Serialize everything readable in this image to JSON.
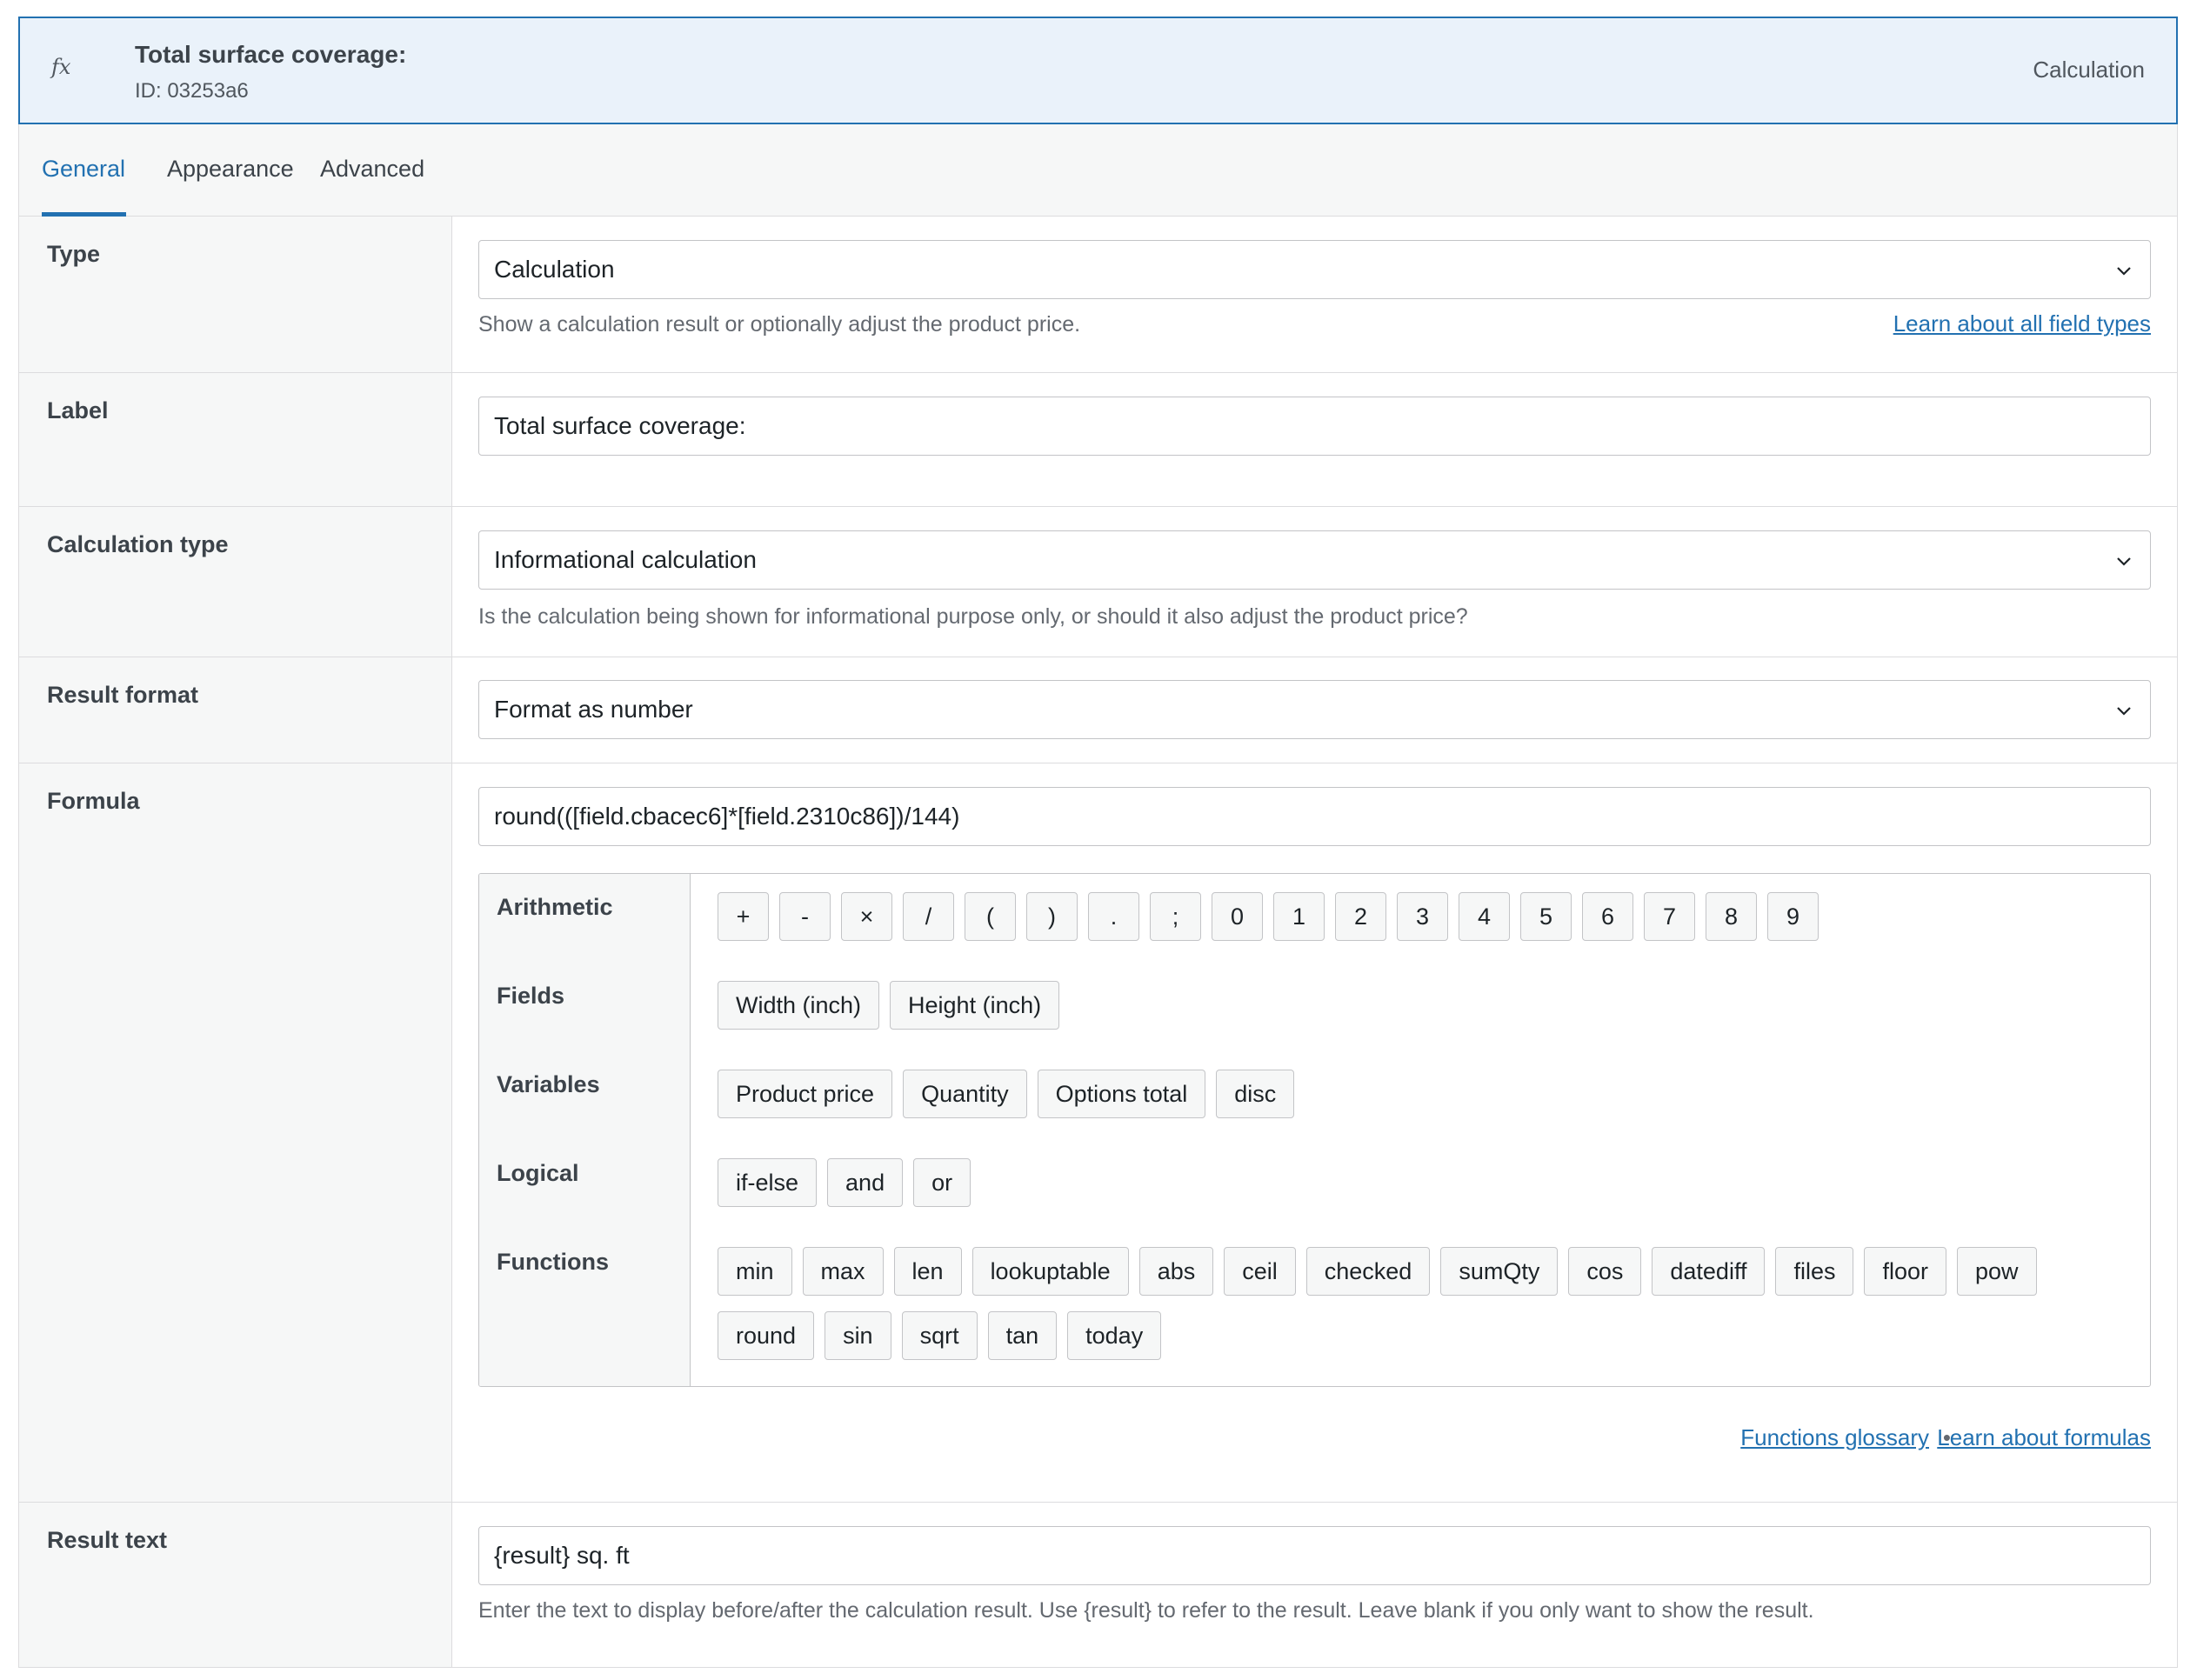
{
  "header": {
    "icon": "fx-icon",
    "title": "Total surface coverage:",
    "id_text": "ID: 03253a6",
    "type_label": "Calculation"
  },
  "tabs": [
    {
      "label": "General",
      "active": true
    },
    {
      "label": "Appearance",
      "active": false
    },
    {
      "label": "Advanced",
      "active": false
    }
  ],
  "type_row": {
    "label": "Type",
    "value": "Calculation",
    "help": "Show a calculation result or optionally adjust the product price.",
    "link": "Learn about all field types"
  },
  "label_row": {
    "label": "Label",
    "value": "Total surface coverage:"
  },
  "calc_type_row": {
    "label": "Calculation type",
    "value": "Informational calculation",
    "help": "Is the calculation being shown for informational purpose only, or should it also adjust the product price?"
  },
  "result_format_row": {
    "label": "Result format",
    "value": "Format as number"
  },
  "formula_row": {
    "label": "Formula",
    "value": "round(([field.cbacec6]*[field.2310c86])/144)",
    "categories": {
      "arithmetic": "Arithmetic",
      "fields": "Fields",
      "variables": "Variables",
      "logical": "Logical",
      "functions": "Functions"
    },
    "arithmetic": [
      "+",
      "-",
      "×",
      "/",
      "(",
      ")",
      ".",
      ";",
      "0",
      "1",
      "2",
      "3",
      "4",
      "5",
      "6",
      "7",
      "8",
      "9"
    ],
    "fields": [
      "Width (inch)",
      "Height (inch)"
    ],
    "variables": [
      "Product price",
      "Quantity",
      "Options total",
      "disc"
    ],
    "logical": [
      "if-else",
      "and",
      "or"
    ],
    "functions": [
      "min",
      "max",
      "len",
      "lookuptable",
      "abs",
      "ceil",
      "checked",
      "sumQty",
      "cos",
      "datediff",
      "files",
      "floor",
      "pow",
      "round",
      "sin",
      "sqrt",
      "tan",
      "today"
    ],
    "link_glossary": "Functions glossary",
    "separator": "•",
    "link_formulas": "Learn about formulas"
  },
  "result_text_row": {
    "label": "Result text",
    "value": "{result} sq. ft",
    "help": "Enter the text to display before/after the calculation result. Use {result} to refer to the result. Leave blank if you only want to show the result."
  },
  "colors": {
    "accent": "#2271b1",
    "header_bg": "#eaf2fa",
    "panel_bg": "#f6f7f7",
    "border": "#dcdcde"
  }
}
